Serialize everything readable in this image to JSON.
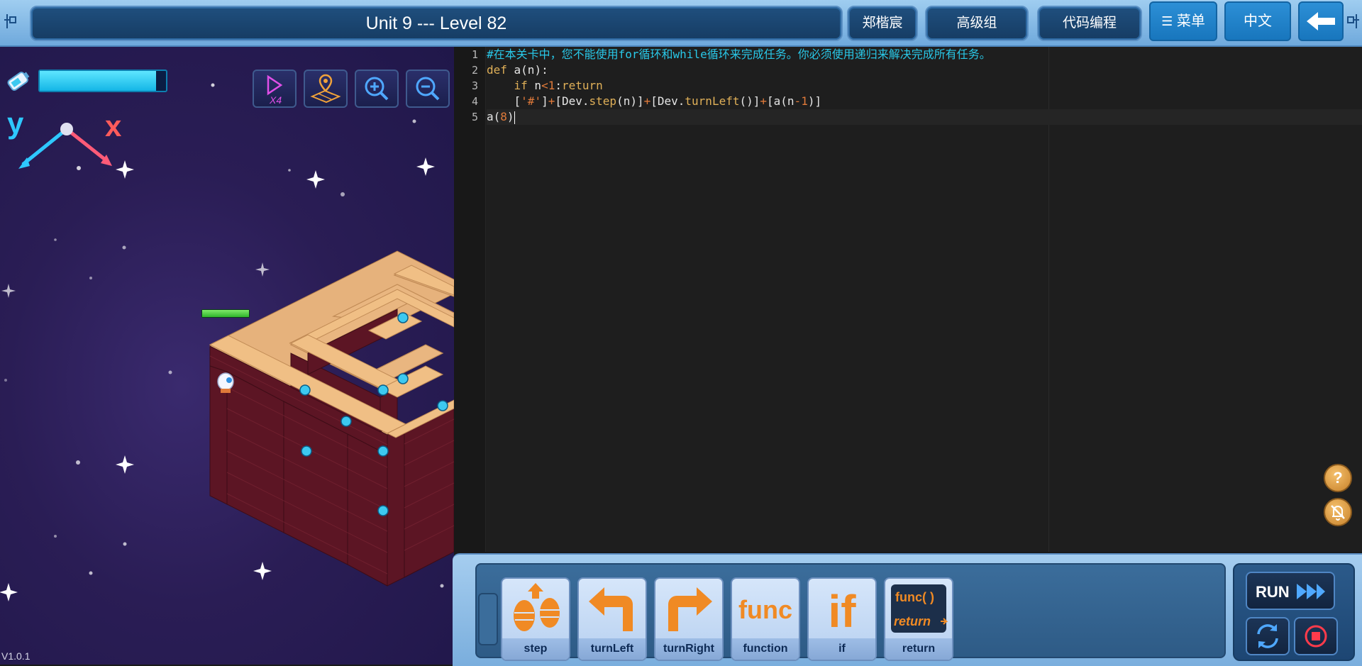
{
  "header": {
    "title": "Unit 9 --- Level 82",
    "user_name": "郑楷宸",
    "group": "高级组",
    "mode": "代码编程",
    "menu_label": "菜单",
    "language": "中文"
  },
  "game": {
    "energy_level": 0.92,
    "robot_health": 1.0,
    "axis_y": "y",
    "axis_x": "x",
    "speed_badge": "X4",
    "version": "V1.0.1"
  },
  "editor": {
    "line_numbers": [
      "1",
      "2",
      "3",
      "4",
      "5"
    ],
    "lines": [
      "#在本关卡中，您不能使用for循环和while循环来完成任务。你必须使用递归来解决完成所有任务。",
      "def a(n):",
      "    if n<1:return",
      "    ['#']+[Dev.step(n)]+[Dev.turnLeft()]+[a(n-1)]",
      "a(8)"
    ]
  },
  "blocks": [
    {
      "label": "step",
      "icon": "step-icon"
    },
    {
      "label": "turnLeft",
      "icon": "turn-left-arrow-icon"
    },
    {
      "label": "turnRight",
      "icon": "turn-right-arrow-icon"
    },
    {
      "label": "function",
      "icon": "func-text-icon",
      "icon_text": "func"
    },
    {
      "label": "if",
      "icon": "if-text-icon",
      "icon_text": "if"
    },
    {
      "label": "return",
      "icon": "func-return-icon",
      "icon_text_top": "func( )",
      "icon_text_bottom": "return"
    }
  ],
  "controls": {
    "run_label": "RUN"
  },
  "colors": {
    "accent": "#1876bd",
    "code_comment": "#29c8e8",
    "code_keyword": "#e0b058",
    "code_number": "#e07a3a",
    "energy": "#14b6e6"
  }
}
